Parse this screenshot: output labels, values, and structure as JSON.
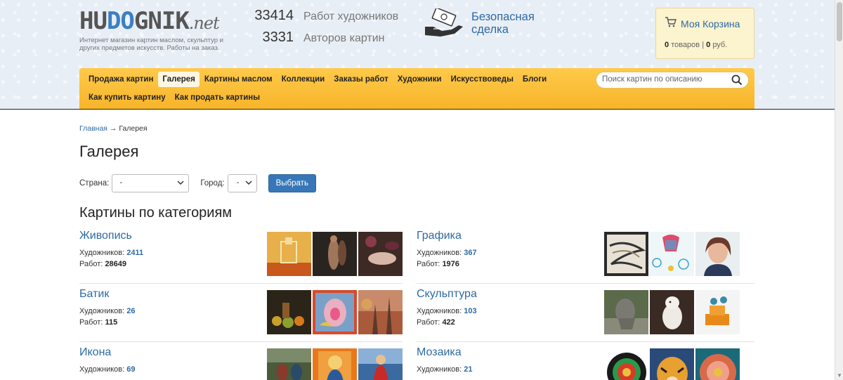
{
  "logo": {
    "text_pre": "HU",
    "text_o": "DO",
    "text_post": "GNIK",
    "net": ".net"
  },
  "tagline": "Интернет магазин картин маслом, скульптур и других предметов искусств. Работы на заказ.",
  "stats": [
    {
      "value": "33414",
      "label": "Работ художников"
    },
    {
      "value": "3331",
      "label": "Авторов картин"
    }
  ],
  "safe_deal": {
    "line1": "Безопасная",
    "line2": "сделка"
  },
  "cart": {
    "title": "Моя Корзина",
    "items_count": "0",
    "items_label": "товаров",
    "sum": "0",
    "currency": "руб."
  },
  "nav": {
    "row1": [
      "Продажа картин",
      "Галерея",
      "Картины маслом",
      "Коллекции",
      "Заказы работ",
      "Художники",
      "Искусствоведы",
      "Блоги"
    ],
    "row2": [
      "Как купить картину",
      "Как продать картины"
    ],
    "active": "Галерея"
  },
  "search": {
    "placeholder": "Поиск картин по описанию"
  },
  "breadcrumb": {
    "home": "Главная",
    "sep": "→",
    "current": "Галерея"
  },
  "page_title": "Галерея",
  "filters": {
    "country_label": "Страна:",
    "country_value": "-",
    "city_label": "Город:",
    "city_value": "-",
    "submit": "Выбрать"
  },
  "section_title": "Картины по категориям",
  "categories": [
    {
      "name": "Живопись",
      "artists_label": "Художников:",
      "artists": "2411",
      "works_label": "Работ:",
      "works": "28649"
    },
    {
      "name": "Графика",
      "artists_label": "Художников:",
      "artists": "367",
      "works_label": "Работ:",
      "works": "1976"
    },
    {
      "name": "Батик",
      "artists_label": "Художников:",
      "artists": "26",
      "works_label": "Работ:",
      "works": "115"
    },
    {
      "name": "Скульптура",
      "artists_label": "Художников:",
      "artists": "103",
      "works_label": "Работ:",
      "works": "422"
    },
    {
      "name": "Икона",
      "artists_label": "Художников:",
      "artists": "69",
      "works_label": "",
      "works": ""
    },
    {
      "name": "Мозаика",
      "artists_label": "Художников:",
      "artists": "21",
      "works_label": "",
      "works": ""
    }
  ],
  "colors": {
    "link": "#2d6aa3",
    "nav_bg": "#f7b52a",
    "button": "#3777b8"
  }
}
